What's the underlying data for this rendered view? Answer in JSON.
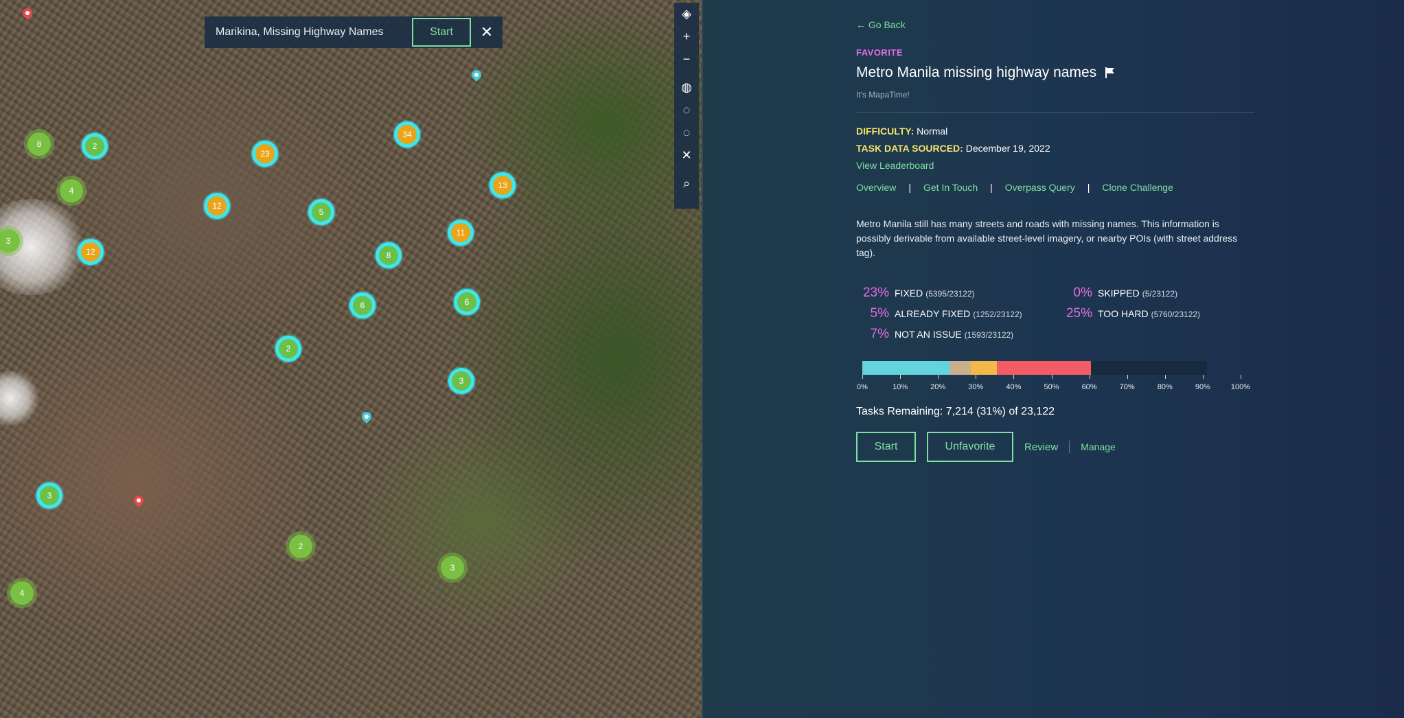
{
  "map": {
    "search_label": "Marikina, Missing Highway Names",
    "start_label": "Start",
    "close_glyph": "✕",
    "tools": [
      {
        "name": "layers-icon",
        "glyph": "◈"
      },
      {
        "name": "zoom-in-icon",
        "glyph": "+"
      },
      {
        "name": "zoom-out-icon",
        "glyph": "−"
      },
      {
        "name": "globe-icon",
        "glyph": "◍"
      },
      {
        "name": "lasso-select-icon",
        "glyph": "◌"
      },
      {
        "name": "lasso-deselect-icon",
        "glyph": "◌"
      },
      {
        "name": "clear-selection-icon",
        "glyph": "✕"
      },
      {
        "name": "search-icon",
        "glyph": "⌕"
      }
    ],
    "clusters": [
      {
        "count": "8",
        "style": "green"
      },
      {
        "count": "2",
        "style": "cyan"
      },
      {
        "count": "4",
        "style": "green"
      },
      {
        "count": "23",
        "style": "gold"
      },
      {
        "count": "34",
        "style": "gold"
      },
      {
        "count": "12",
        "style": "gold"
      },
      {
        "count": "5",
        "style": "cyan"
      },
      {
        "count": "13",
        "style": "gold"
      },
      {
        "count": "3",
        "style": "green"
      },
      {
        "count": "12",
        "style": "gold"
      },
      {
        "count": "11",
        "style": "gold"
      },
      {
        "count": "8",
        "style": "cyan"
      },
      {
        "count": "6",
        "style": "cyan"
      },
      {
        "count": "6",
        "style": "cyan"
      },
      {
        "count": "2",
        "style": "cyan"
      },
      {
        "count": "3",
        "style": "cyan"
      },
      {
        "count": "3",
        "style": "cyan"
      },
      {
        "count": "2",
        "style": "green"
      },
      {
        "count": "3",
        "style": "green"
      },
      {
        "count": "4",
        "style": "green"
      }
    ]
  },
  "panel": {
    "go_back": "← Go Back",
    "favorite": "FAVORITE",
    "title": "Metro Manila missing highway names",
    "owner": "It's MapaTime!",
    "difficulty_key": "DIFFICULTY:",
    "difficulty_value": "Normal",
    "sourced_key": "TASK DATA SOURCED:",
    "sourced_value": "December 19, 2022",
    "leaderboard": "View Leaderboard",
    "links": [
      "Overview",
      "Get In Touch",
      "Overpass Query",
      "Clone Challenge"
    ],
    "link_sep": "|",
    "description": "Metro Manila still has many streets and roads with missing names. This information is possibly derivable from available street-level imagery, or nearby POIs (with street address tag).",
    "stats": [
      {
        "pct": "23%",
        "label": "FIXED",
        "count": "(5395/23122)"
      },
      {
        "pct": "5%",
        "label": "ALREADY FIXED",
        "count": "(1252/23122)"
      },
      {
        "pct": "7%",
        "label": "NOT AN ISSUE",
        "count": "(1593/23122)"
      },
      {
        "pct": "0%",
        "label": "SKIPPED",
        "count": "(5/23122)"
      },
      {
        "pct": "25%",
        "label": "TOO HARD",
        "count": "(5760/23122)"
      }
    ],
    "progress": {
      "segments": [
        {
          "label": "FIXED",
          "value": 23.3,
          "color": "#65d3dc"
        },
        {
          "label": "ALREADY FIXED",
          "value": 5.4,
          "color": "#c9b08a"
        },
        {
          "label": "NOT AN ISSUE",
          "value": 6.9,
          "color": "#f2b84b"
        },
        {
          "label": "TOO HARD",
          "value": 24.9,
          "color": "#f25c66"
        }
      ],
      "remaining_color": "#172a3e",
      "ticks": [
        "0%",
        "10%",
        "20%",
        "30%",
        "40%",
        "50%",
        "60%",
        "70%",
        "80%",
        "90%",
        "100%"
      ]
    },
    "remaining": "Tasks Remaining: 7,214 (31%) of 23,122",
    "start_label": "Start",
    "unfavorite_label": "Unfavorite",
    "review_label": "Review",
    "manage_label": "Manage"
  }
}
